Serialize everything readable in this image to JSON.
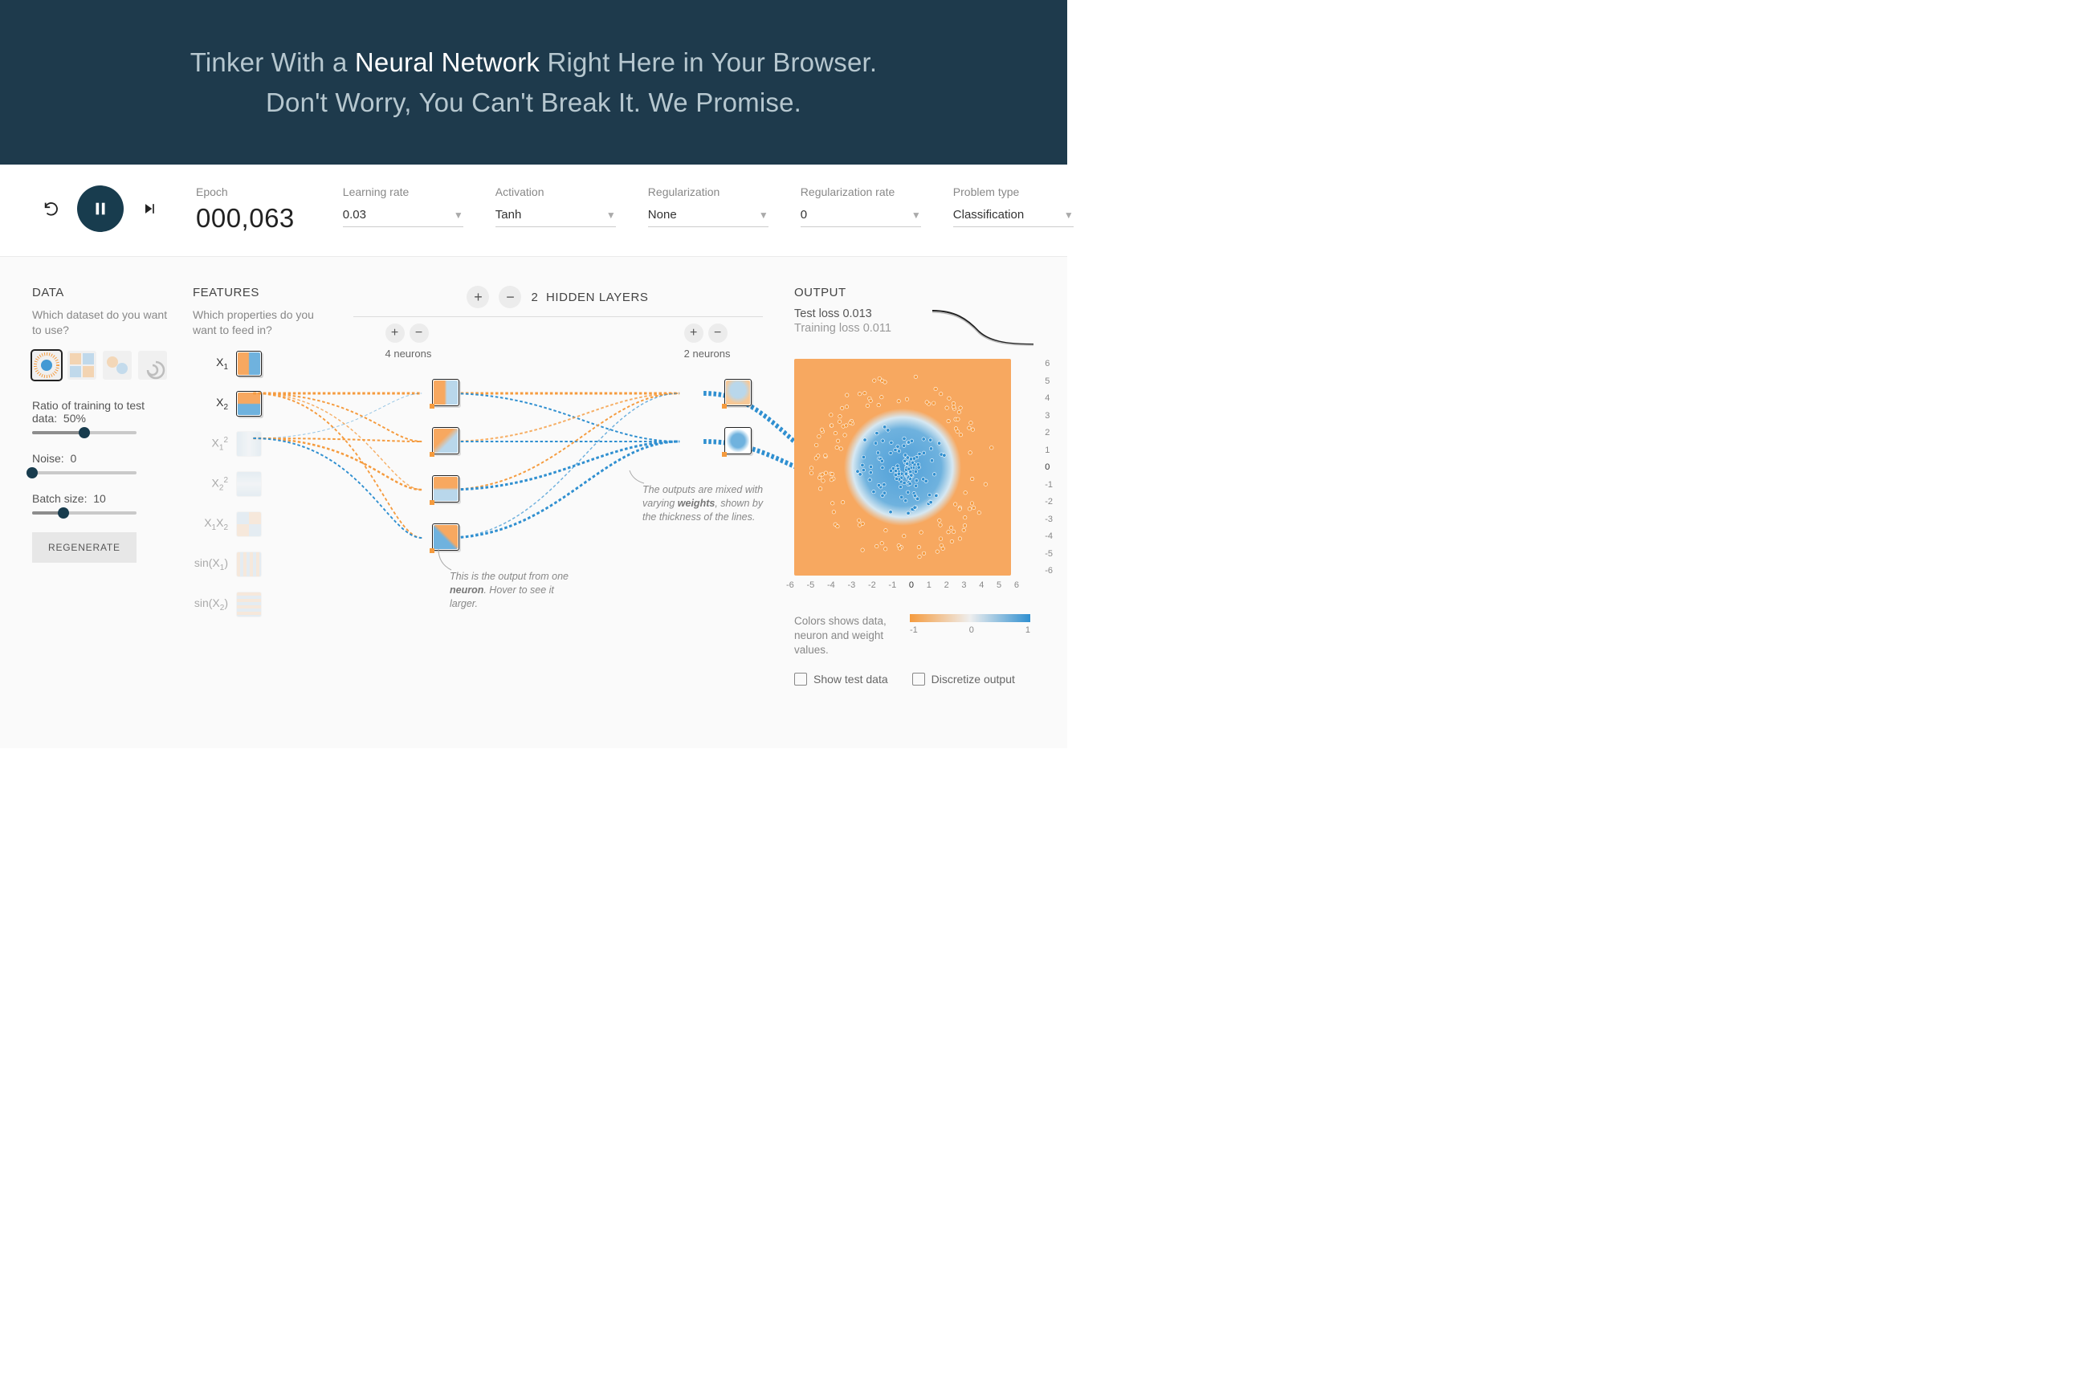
{
  "hero": {
    "line1_pre": "Tinker With a ",
    "line1_strong": "Neural Network",
    "line1_post": " Right Here in Your Browser.",
    "line2": "Don't Worry, You Can't Break It. We Promise."
  },
  "controls": {
    "epoch_label": "Epoch",
    "epoch_value": "000,063",
    "learning_rate": {
      "label": "Learning rate",
      "value": "0.03"
    },
    "activation": {
      "label": "Activation",
      "value": "Tanh"
    },
    "regularization": {
      "label": "Regularization",
      "value": "None"
    },
    "regularization_rate": {
      "label": "Regularization rate",
      "value": "0"
    },
    "problem_type": {
      "label": "Problem type",
      "value": "Classification"
    }
  },
  "data": {
    "title": "DATA",
    "subtitle": "Which dataset do you want to use?",
    "datasets": [
      {
        "name": "circle",
        "selected": true
      },
      {
        "name": "xor",
        "selected": false
      },
      {
        "name": "gauss",
        "selected": false
      },
      {
        "name": "spiral",
        "selected": false
      }
    ],
    "ratio": {
      "label": "Ratio of training to test data:",
      "value": "50%",
      "pct": 50
    },
    "noise": {
      "label": "Noise:",
      "value": "0",
      "pct": 0
    },
    "batch": {
      "label": "Batch size:",
      "value": "10",
      "pct": 30
    },
    "regenerate": "REGENERATE"
  },
  "features": {
    "title": "FEATURES",
    "subtitle": "Which properties do you want to feed in?",
    "items": [
      {
        "id": "x1",
        "label_html": "X<sub>1</sub>",
        "active": true
      },
      {
        "id": "x2",
        "label_html": "X<sub>2</sub>",
        "active": true
      },
      {
        "id": "x1sq",
        "label_html": "X<sub>1</sub><sup>2</sup>",
        "active": false
      },
      {
        "id": "x2sq",
        "label_html": "X<sub>2</sub><sup>2</sup>",
        "active": false
      },
      {
        "id": "x1x2",
        "label_html": "X<sub>1</sub>X<sub>2</sub>",
        "active": false
      },
      {
        "id": "sinx1",
        "label_html": "sin(X<sub>1</sub>)",
        "active": false
      },
      {
        "id": "sinx2",
        "label_html": "sin(X<sub>2</sub>)",
        "active": false
      }
    ]
  },
  "network": {
    "hidden_count": "2",
    "hidden_label": "HIDDEN LAYERS",
    "layers": [
      {
        "neurons_label": "4 neurons",
        "count": 4
      },
      {
        "neurons_label": "2 neurons",
        "count": 2
      }
    ],
    "callout_neuron_l1": "This is the output from one ",
    "callout_neuron_b": "neuron",
    "callout_neuron_l2": ". Hover to see it larger.",
    "callout_weights_l1": "The outputs are mixed with varying ",
    "callout_weights_b": "weights",
    "callout_weights_l2": ", shown by the thickness of the lines."
  },
  "output": {
    "title": "OUTPUT",
    "test_loss_label": "Test loss ",
    "test_loss_value": "0.013",
    "train_loss_label": "Training loss ",
    "train_loss_value": "0.011",
    "axis_ticks_y": [
      "6",
      "5",
      "4",
      "3",
      "2",
      "1",
      "0",
      "-1",
      "-2",
      "-3",
      "-4",
      "-5",
      "-6"
    ],
    "axis_ticks_x": [
      "-6",
      "-5",
      "-4",
      "-3",
      "-2",
      "-1",
      "0",
      "1",
      "2",
      "3",
      "4",
      "5",
      "6"
    ],
    "legend_text": "Colors shows data, neuron and weight values.",
    "gradient_labels": [
      "-1",
      "0",
      "1"
    ],
    "show_test": "Show test data",
    "discretize": "Discretize output"
  },
  "chart_data": {
    "type": "scatter",
    "title": "",
    "xlabel": "",
    "ylabel": "",
    "xlim": [
      -6,
      6
    ],
    "ylim": [
      -6,
      6
    ],
    "background": "decision-surface: blue blob centered ~(0,0) radius~2.4 on orange field",
    "series": [
      {
        "name": "class-blue",
        "approx_count": 120,
        "region": "inside radius ~2.2 of origin"
      },
      {
        "name": "class-orange",
        "approx_count": 120,
        "region": "ring between radius ~3 and ~5"
      }
    ],
    "loss_curve": {
      "type": "line",
      "x": [
        0,
        10,
        20,
        30,
        40,
        50,
        63
      ],
      "test": [
        0.55,
        0.4,
        0.22,
        0.1,
        0.04,
        0.02,
        0.013
      ],
      "train": [
        0.55,
        0.38,
        0.2,
        0.09,
        0.035,
        0.018,
        0.011
      ]
    }
  }
}
